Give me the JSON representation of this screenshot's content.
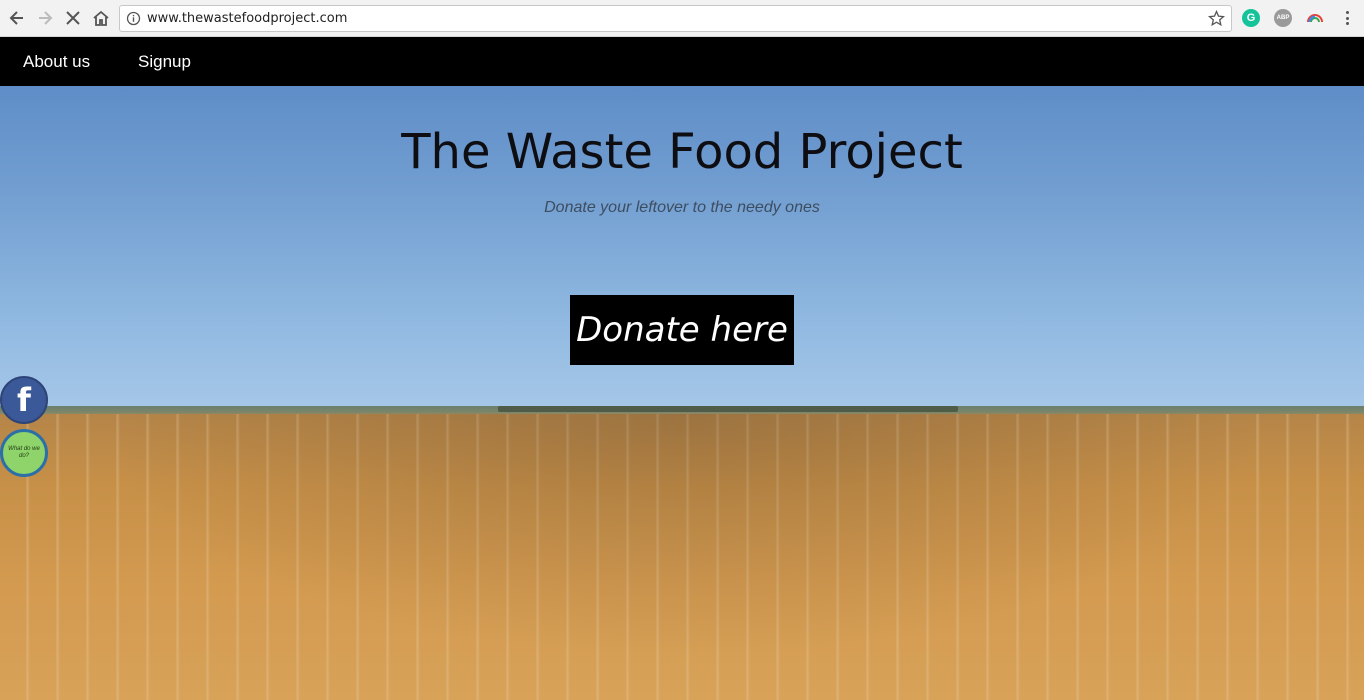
{
  "browser": {
    "url": "www.thewastefoodproject.com",
    "icons": [
      "back-icon",
      "forward-icon",
      "stop-icon",
      "home-icon",
      "info-icon",
      "star-icon"
    ],
    "extensions": [
      {
        "name": "grammarly-icon",
        "label": "G",
        "color": "#15c39a"
      },
      {
        "name": "adblock-icon",
        "label": "ABP",
        "color": "#9a9a9a"
      }
    ]
  },
  "nav": {
    "about_label": "About us",
    "signup_label": "Signup"
  },
  "hero": {
    "title": "The Waste Food Project",
    "subtitle": "Donate your leftover to the needy ones",
    "donate_label": "Donate here"
  },
  "social": {
    "facebook_glyph": "f",
    "whatwedo_label": "What do we do?"
  },
  "colors": {
    "nav_bg": "#000000",
    "button_bg": "#000000",
    "facebook": "#3b5998",
    "whatwedo": "#8fd36b"
  }
}
